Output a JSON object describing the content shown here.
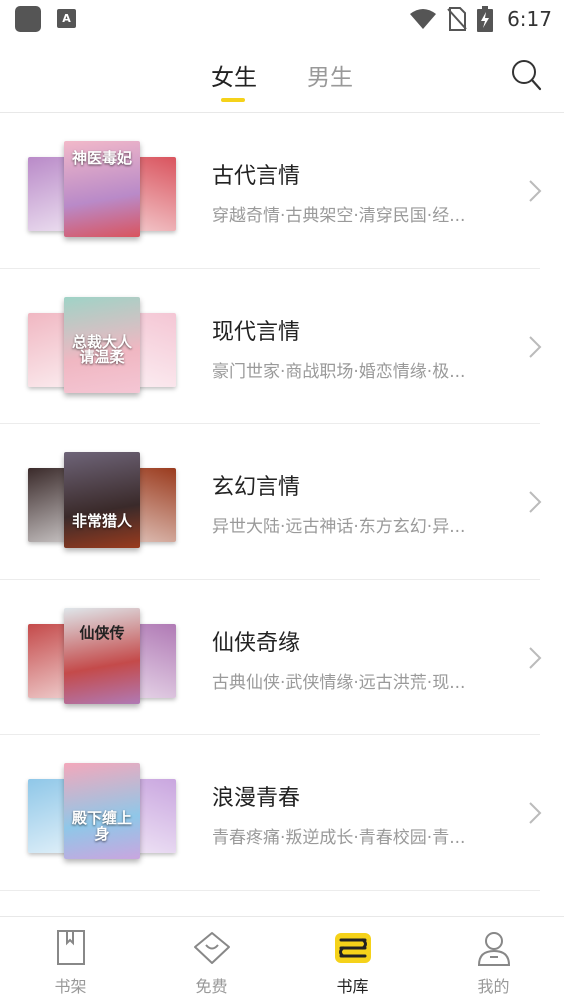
{
  "status_bar": {
    "time": "6:17",
    "a_icon_label": "A",
    "icons": [
      "app-icon",
      "a-icon",
      "wifi-icon",
      "no-sim-icon",
      "battery-charging-icon"
    ]
  },
  "tabs": {
    "female": "女生",
    "male": "男生",
    "active": "female"
  },
  "categories": [
    {
      "title": "古代言情",
      "desc": "穿越奇情·古典架空·清穿民国·经...",
      "cover_text": "神医毒妃",
      "colors": [
        "#b98ac8",
        "#f2b9c9",
        "#d9545e"
      ]
    },
    {
      "title": "现代言情",
      "desc": "豪门世家·商战职场·婚恋情缘·极...",
      "cover_text": "总裁大人请温柔",
      "colors": [
        "#f0b7c2",
        "#9fd3c6",
        "#f4c6d4"
      ]
    },
    {
      "title": "玄幻言情",
      "desc": "异世大陆·远古神话·东方玄幻·异...",
      "cover_text": "非常猎人",
      "colors": [
        "#3a2a2a",
        "#6e6478",
        "#9a3b1e"
      ]
    },
    {
      "title": "仙侠奇缘",
      "desc": "古典仙侠·武侠情缘·远古洪荒·现...",
      "cover_text": "仙侠传",
      "colors": [
        "#c44a4a",
        "#dfe6ea",
        "#b07ab5"
      ]
    },
    {
      "title": "浪漫青春",
      "desc": "青春疼痛·叛逆成长·青春校园·青...",
      "cover_text": "殿下缠上身",
      "colors": [
        "#8fc7e8",
        "#f3a8bb",
        "#c9a6df"
      ]
    }
  ],
  "bottom_nav": [
    {
      "label": "书架",
      "icon": "bookshelf-icon",
      "active": false
    },
    {
      "label": "免费",
      "icon": "free-gift-icon",
      "active": false
    },
    {
      "label": "书库",
      "icon": "library-icon",
      "active": true
    },
    {
      "label": "我的",
      "icon": "profile-icon",
      "active": false
    }
  ],
  "theme": {
    "accent": "#f5d21a",
    "text_primary": "#222222",
    "text_secondary": "#9a9a9a"
  }
}
